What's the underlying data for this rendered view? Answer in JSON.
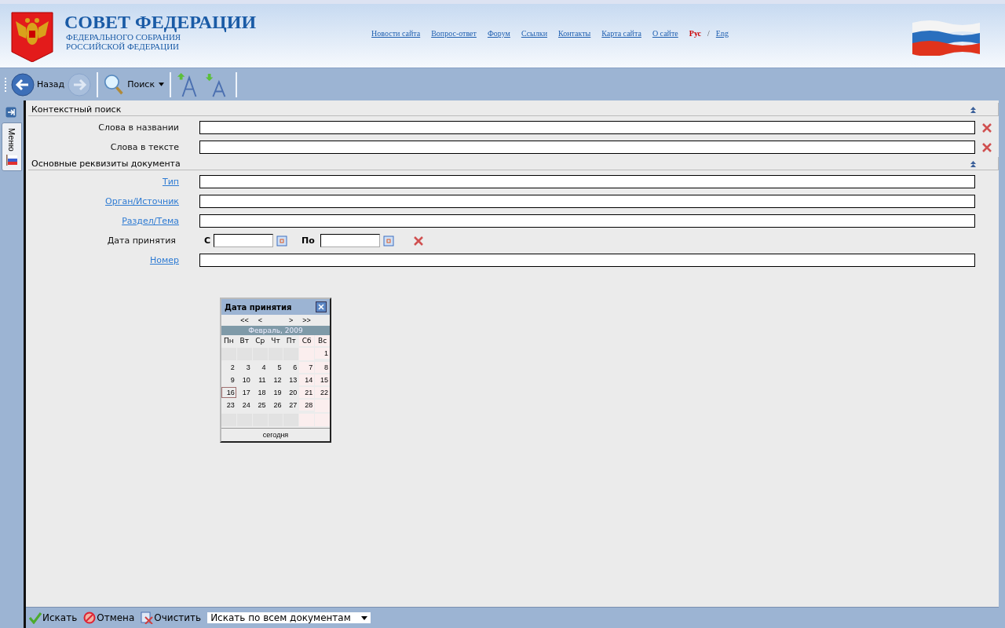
{
  "header": {
    "title": "СОВЕТ ФЕДЕРАЦИИ",
    "subtitle_lines": [
      "ФЕДЕРАЛЬНОГО СОБРАНИЯ",
      "РОССИЙСКОЙ ФЕДЕРАЦИИ"
    ],
    "nav_links": [
      {
        "label": "Новости сайта",
        "selected": false
      },
      {
        "label": "Вопрос-ответ",
        "selected": false
      },
      {
        "label": "Форум",
        "selected": false
      },
      {
        "label": "Ссылки",
        "selected": false
      },
      {
        "label": "Контакты",
        "selected": false
      },
      {
        "label": "Карта сайта",
        "selected": false
      },
      {
        "label": "О сайте",
        "selected": false
      }
    ],
    "languages": [
      {
        "label": "Рус",
        "selected": true
      },
      {
        "label": "Eng",
        "selected": false
      }
    ],
    "language_separator": "/"
  },
  "toolbar": {
    "back_label": "Назад",
    "forward_disabled": true,
    "search_label": "Поиск"
  },
  "side_tab": {
    "label": "Меню"
  },
  "sections": [
    {
      "title": "Контекстный поиск",
      "fields": [
        {
          "kind": "text",
          "label": "Слова в названии",
          "link": false,
          "clearable": true
        },
        {
          "kind": "text",
          "label": "Слова в тексте",
          "link": false,
          "clearable": true
        }
      ]
    },
    {
      "title": "Основные реквизиты документа",
      "fields": [
        {
          "kind": "text",
          "label": "Тип",
          "link": true,
          "clearable": false
        },
        {
          "kind": "text",
          "label": "Орган/Источник",
          "link": true,
          "clearable": false
        },
        {
          "kind": "text",
          "label": "Раздел/Тема",
          "link": true,
          "clearable": false
        },
        {
          "kind": "date",
          "label": "Дата принятия",
          "link": false,
          "clearable": true,
          "from_label": "С",
          "to_label": "По"
        },
        {
          "kind": "text",
          "label": "Номер",
          "link": true,
          "clearable": false
        }
      ]
    }
  ],
  "calendar": {
    "title": "Дата принятия",
    "nav": [
      "<<",
      "<",
      ">",
      ">>"
    ],
    "month": "Февраль, 2009",
    "weekdays": [
      "Пн",
      "Вт",
      "Ср",
      "Чт",
      "Пт",
      "Сб",
      "Вс"
    ],
    "weeks": [
      [
        {
          "kind": "blank"
        },
        {
          "kind": "blank"
        },
        {
          "kind": "blank"
        },
        {
          "kind": "blank"
        },
        {
          "kind": "blank"
        },
        {
          "kind": "blank"
        },
        {
          "kind": "day",
          "label": "1",
          "selected": false
        }
      ],
      [
        {
          "label": "2",
          "selected": false
        },
        {
          "label": "3",
          "selected": false
        },
        {
          "label": "4",
          "selected": false
        },
        {
          "label": "5",
          "selected": false
        },
        {
          "label": "6",
          "selected": false
        },
        {
          "label": "7",
          "selected": false
        },
        {
          "label": "8",
          "selected": false
        }
      ],
      [
        {
          "label": "9",
          "selected": false
        },
        {
          "label": "10",
          "selected": false
        },
        {
          "label": "11",
          "selected": false
        },
        {
          "label": "12",
          "selected": false
        },
        {
          "label": "13",
          "selected": false
        },
        {
          "label": "14",
          "selected": false
        },
        {
          "label": "15",
          "selected": false
        }
      ],
      [
        {
          "label": "16",
          "selected": true
        },
        {
          "label": "17",
          "selected": false
        },
        {
          "label": "18",
          "selected": false
        },
        {
          "label": "19",
          "selected": false
        },
        {
          "label": "20",
          "selected": false
        },
        {
          "label": "21",
          "selected": false
        },
        {
          "label": "22",
          "selected": false
        }
      ],
      [
        {
          "label": "23",
          "selected": false
        },
        {
          "label": "24",
          "selected": false
        },
        {
          "label": "25",
          "selected": false
        },
        {
          "label": "26",
          "selected": false
        },
        {
          "label": "27",
          "selected": false
        },
        {
          "label": "28",
          "selected": false
        },
        {
          "kind": "blank"
        }
      ],
      [
        {
          "kind": "blank"
        },
        {
          "kind": "blank"
        },
        {
          "kind": "blank"
        },
        {
          "kind": "blank"
        },
        {
          "kind": "blank"
        },
        {
          "kind": "blank"
        },
        {
          "kind": "blank"
        }
      ]
    ],
    "today_label": "сегодня"
  },
  "bottom_bar": {
    "search_label": "Искать",
    "cancel_label": "Отмена",
    "clear_label": "Очистить",
    "scope": "Искать по всем документам"
  }
}
